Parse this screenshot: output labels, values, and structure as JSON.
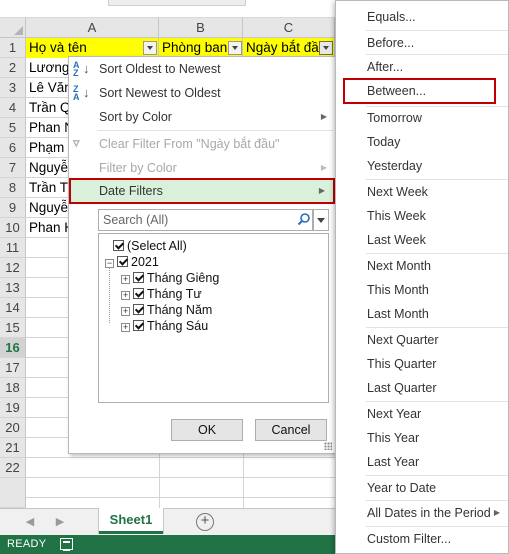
{
  "sheet": {
    "columns": [
      "A",
      "B",
      "C"
    ],
    "headers": [
      "Họ và tên",
      "Phòng ban",
      "Ngày bắt đầ"
    ],
    "row_numbers": [
      "1",
      "2",
      "3",
      "4",
      "5",
      "6",
      "7",
      "8",
      "9",
      "10",
      "11",
      "12",
      "13",
      "14",
      "15",
      "16",
      "17",
      "18",
      "19",
      "20",
      "21",
      "22"
    ],
    "active_row": "16",
    "visible_cells": [
      "Lương",
      "Lê Văn",
      "Trần Q",
      "Phan N",
      "Phạm",
      "Nguyễ",
      "Trần T",
      "Nguyễ",
      "Phan H"
    ],
    "header_fill_color": "#ffff00"
  },
  "filter_menu": {
    "sort_oldest": "Sort Oldest to Newest",
    "sort_newest": "Sort Newest to Oldest",
    "sort_by_color": "Sort by Color",
    "clear_filter": "Clear Filter From \"Ngày bắt đầu\"",
    "filter_by_color": "Filter by Color",
    "date_filters": "Date Filters",
    "search_placeholder": "Search (All)",
    "tree": {
      "select_all": "(Select All)",
      "year": "2021",
      "months": [
        "Tháng Giêng",
        "Tháng Tư",
        "Tháng Năm",
        "Tháng Sáu"
      ]
    },
    "ok_label": "OK",
    "cancel_label": "Cancel"
  },
  "date_submenu": {
    "items": [
      "Equals...",
      "Before...",
      "After...",
      "Between...",
      "Tomorrow",
      "Today",
      "Yesterday",
      "Next Week",
      "This Week",
      "Last Week",
      "Next Month",
      "This Month",
      "Last Month",
      "Next Quarter",
      "This Quarter",
      "Last Quarter",
      "Next Year",
      "This Year",
      "Last Year",
      "Year to Date",
      "All Dates in the Period",
      "Custom Filter..."
    ],
    "highlight_color": "#c00000"
  },
  "tabs": {
    "sheet_name": "Sheet1",
    "add_sheet": "+"
  },
  "status": {
    "ready": "READY",
    "accent_color": "#217346"
  }
}
